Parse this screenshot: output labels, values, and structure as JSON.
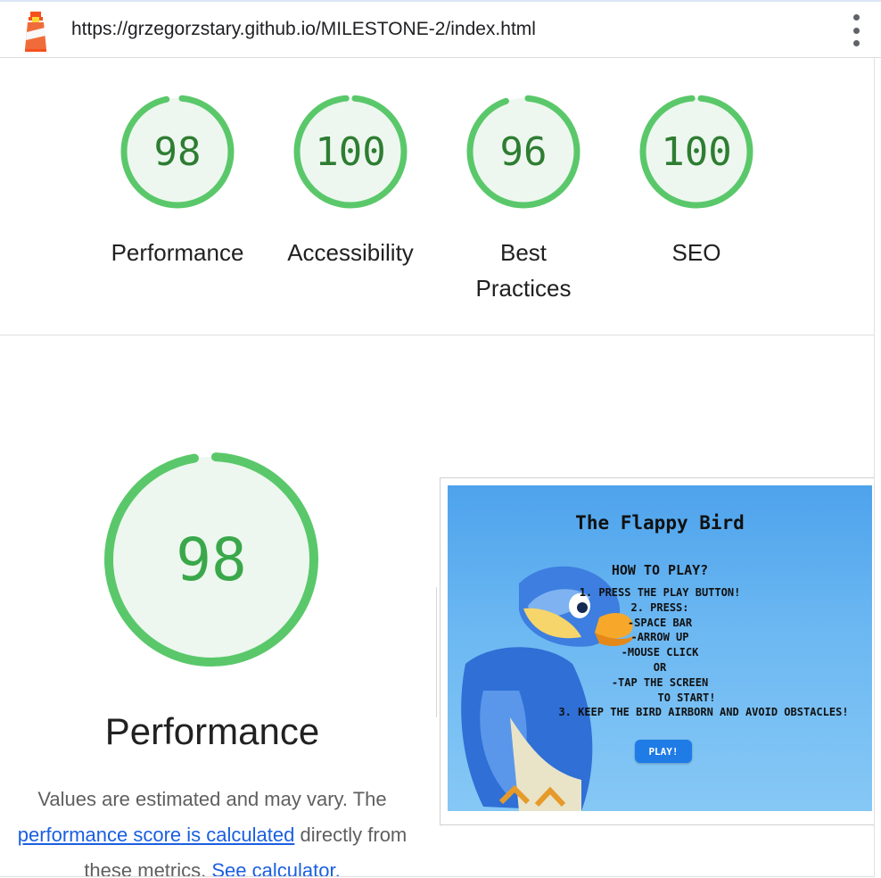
{
  "browser": {
    "url": "https://grzegorzstary.github.io/MILESTONE-2/index.html",
    "logo_icon": "lighthouse-icon",
    "menu_icon": "vertical-dots-icon"
  },
  "scores": [
    {
      "value": 98,
      "label": "Performance"
    },
    {
      "value": 100,
      "label": "Accessibility"
    },
    {
      "value": 96,
      "label": "Best Practices"
    },
    {
      "value": 100,
      "label": "SEO"
    }
  ],
  "performance": {
    "score": 98,
    "title": "Performance",
    "desc_line1": "Values are estimated and may vary. The",
    "link_score": "performance score is calculated",
    "desc_line2_tail": "directly from",
    "desc_line3": "these metrics.",
    "link_calc": "See calculator."
  },
  "screenshot": {
    "title": "The Flappy Bird",
    "howto": "HOW TO PLAY?",
    "lines": [
      "1. PRESS THE PLAY BUTTON!",
      "2. PRESS:",
      "-SPACE BAR",
      "-ARROW UP",
      "-MOUSE CLICK",
      "OR",
      "-TAP THE SCREEN",
      "TO START!",
      "3. KEEP THE BIRD AIRBORN AND AVOID OBSTACLES!"
    ],
    "play_button": "PLAY!"
  },
  "colors": {
    "pass_green": "#0cce6b",
    "gauge_ring": "#5ac86a",
    "gauge_fill": "#edf7ef",
    "score_text": "#2e7d32",
    "link": "#1a5fe0"
  }
}
